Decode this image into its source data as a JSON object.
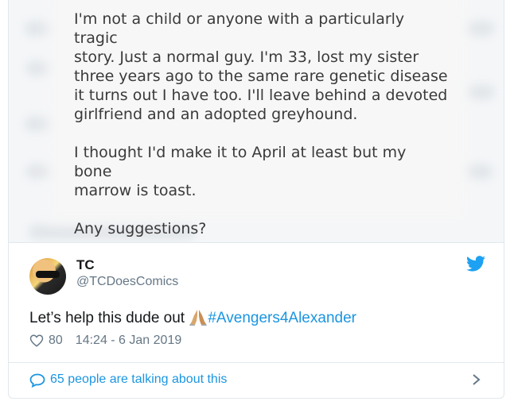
{
  "quote": {
    "paragraphs": [
      "I'm not a child or anyone with a particularly tragic\nstory. Just a normal guy. I'm 33, lost my sister\nthree years ago to the same rare genetic disease\nit turns out I have too. I'll leave behind a devoted\ngirlfriend and an adopted greyhound.",
      "I thought I'd make it to April at least but my bone\nmarrow is toast.",
      "Any suggestions?"
    ]
  },
  "tweet": {
    "name": "TC",
    "handle": "@TCDoesComics",
    "text_before": "Let’s help this dude out ",
    "hashtag": "#Avengers4Alexander",
    "likes": "80",
    "timestamp": "14:24 - 6 Jan 2019"
  },
  "footer": {
    "talking": "65 people are talking about this"
  },
  "colors": {
    "link": "#1b95e0",
    "muted": "#657786",
    "text": "#14171a",
    "twitter_blue": "#1da1f2"
  }
}
